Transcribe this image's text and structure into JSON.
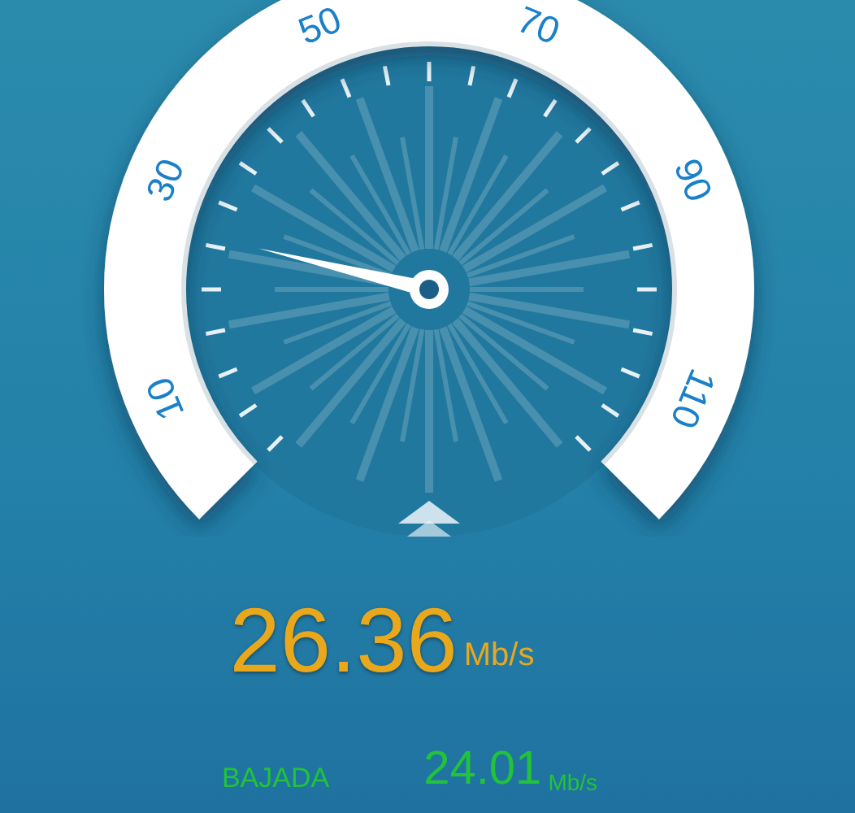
{
  "gauge": {
    "scale_labels": [
      "10",
      "30",
      "50",
      "70",
      "90",
      "110"
    ]
  },
  "speed": {
    "value": "26.36",
    "unit": "Mb/s"
  },
  "results": [
    {
      "label": "BAJADA",
      "value": "24.01",
      "unit": "Mb/s"
    }
  ]
}
